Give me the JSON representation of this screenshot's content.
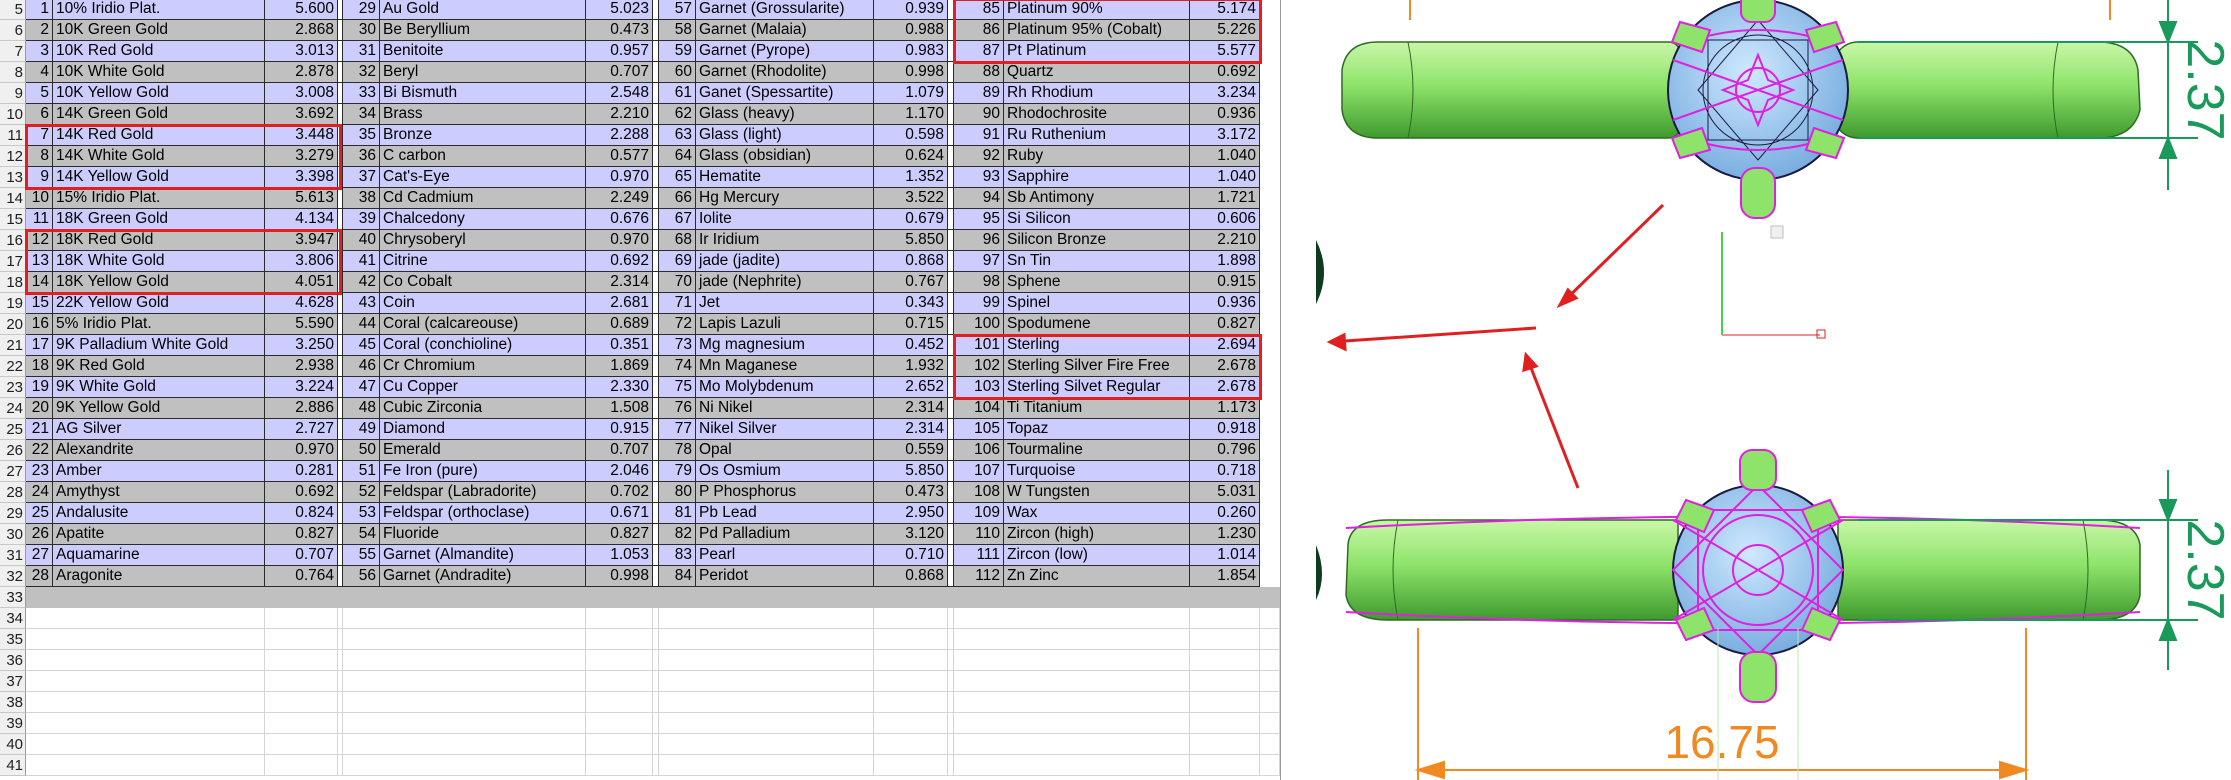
{
  "spreadsheet": {
    "first_row_number": 5,
    "columns": [
      {
        "rows": [
          [
            "1",
            "10% Iridio Plat.",
            "5.600"
          ],
          [
            "2",
            "10K Green Gold",
            "2.868"
          ],
          [
            "3",
            "10K Red Gold",
            "3.013"
          ],
          [
            "4",
            "10K White Gold",
            "2.878"
          ],
          [
            "5",
            "10K Yellow Gold",
            "3.008"
          ],
          [
            "6",
            "14K Green Gold",
            "3.692"
          ],
          [
            "7",
            "14K Red Gold",
            "3.448"
          ],
          [
            "8",
            "14K White Gold",
            "3.279"
          ],
          [
            "9",
            "14K Yellow Gold",
            "3.398"
          ],
          [
            "10",
            "15% Iridio Plat.",
            "5.613"
          ],
          [
            "11",
            "18K Green Gold",
            "4.134"
          ],
          [
            "12",
            "18K Red Gold",
            "3.947"
          ],
          [
            "13",
            "18K White Gold",
            "3.806"
          ],
          [
            "14",
            "18K Yellow Gold",
            "4.051"
          ],
          [
            "15",
            "22K Yellow Gold",
            "4.628"
          ],
          [
            "16",
            "5% Iridio Plat.",
            "5.590"
          ],
          [
            "17",
            "9K Palladium White Gold",
            "3.250"
          ],
          [
            "18",
            "9K Red Gold",
            "2.938"
          ],
          [
            "19",
            "9K White Gold",
            "3.224"
          ],
          [
            "20",
            "9K Yellow Gold",
            "2.886"
          ],
          [
            "21",
            "AG Silver",
            "2.727"
          ],
          [
            "22",
            "Alexandrite",
            "0.970"
          ],
          [
            "23",
            "Amber",
            "0.281"
          ],
          [
            "24",
            "Amythyst",
            "0.692"
          ],
          [
            "25",
            "Andalusite",
            "0.824"
          ],
          [
            "26",
            "Apatite",
            "0.827"
          ],
          [
            "27",
            "Aquamarine",
            "0.707"
          ],
          [
            "28",
            "Aragonite",
            "0.764"
          ]
        ]
      },
      {
        "rows": [
          [
            "29",
            "Au Gold",
            "5.023"
          ],
          [
            "30",
            "Be Beryllium",
            "0.473"
          ],
          [
            "31",
            "Benitoite",
            "0.957"
          ],
          [
            "32",
            "Beryl",
            "0.707"
          ],
          [
            "33",
            "Bi Bismuth",
            "2.548"
          ],
          [
            "34",
            "Brass",
            "2.210"
          ],
          [
            "35",
            "Bronze",
            "2.288"
          ],
          [
            "36",
            "C carbon",
            "0.577"
          ],
          [
            "37",
            "Cat's-Eye",
            "0.970"
          ],
          [
            "38",
            "Cd Cadmium",
            "2.249"
          ],
          [
            "39",
            "Chalcedony",
            "0.676"
          ],
          [
            "40",
            "Chrysoberyl",
            "0.970"
          ],
          [
            "41",
            "Citrine",
            "0.692"
          ],
          [
            "42",
            "Co Cobalt",
            "2.314"
          ],
          [
            "43",
            "Coin",
            "2.681"
          ],
          [
            "44",
            "Coral (calcareouse)",
            "0.689"
          ],
          [
            "45",
            "Coral (conchioline)",
            "0.351"
          ],
          [
            "46",
            "Cr Chromium",
            "1.869"
          ],
          [
            "47",
            "Cu Copper",
            "2.330"
          ],
          [
            "48",
            "Cubic Zirconia",
            "1.508"
          ],
          [
            "49",
            "Diamond",
            "0.915"
          ],
          [
            "50",
            "Emerald",
            "0.707"
          ],
          [
            "51",
            "Fe Iron (pure)",
            "2.046"
          ],
          [
            "52",
            "Feldspar (Labradorite)",
            "0.702"
          ],
          [
            "53",
            "Feldspar (orthoclase)",
            "0.671"
          ],
          [
            "54",
            "Fluoride",
            "0.827"
          ],
          [
            "55",
            "Garnet (Almandite)",
            "1.053"
          ],
          [
            "56",
            "Garnet (Andradite)",
            "0.998"
          ]
        ]
      },
      {
        "rows": [
          [
            "57",
            "Garnet (Grossularite)",
            "0.939"
          ],
          [
            "58",
            "Garnet (Malaia)",
            "0.988"
          ],
          [
            "59",
            "Garnet (Pyrope)",
            "0.983"
          ],
          [
            "60",
            "Garnet (Rhodolite)",
            "0.998"
          ],
          [
            "61",
            "Ganet (Spessartite)",
            "1.079"
          ],
          [
            "62",
            "Glass (heavy)",
            "1.170"
          ],
          [
            "63",
            "Glass (light)",
            "0.598"
          ],
          [
            "64",
            "Glass (obsidian)",
            "0.624"
          ],
          [
            "65",
            "Hematite",
            "1.352"
          ],
          [
            "66",
            "Hg Mercury",
            "3.522"
          ],
          [
            "67",
            "Iolite",
            "0.679"
          ],
          [
            "68",
            "Ir Iridium",
            "5.850"
          ],
          [
            "69",
            "jade (jadite)",
            "0.868"
          ],
          [
            "70",
            "jade (Nephrite)",
            "0.767"
          ],
          [
            "71",
            "Jet",
            "0.343"
          ],
          [
            "72",
            "Lapis Lazuli",
            "0.715"
          ],
          [
            "73",
            "Mg magnesium",
            "0.452"
          ],
          [
            "74",
            "Mn Maganese",
            "1.932"
          ],
          [
            "75",
            "Mo Molybdenum",
            "2.652"
          ],
          [
            "76",
            "Ni Nikel",
            "2.314"
          ],
          [
            "77",
            "Nikel Silver",
            "2.314"
          ],
          [
            "78",
            "Opal",
            "0.559"
          ],
          [
            "79",
            "Os Osmium",
            "5.850"
          ],
          [
            "80",
            "P Phosphorus",
            "0.473"
          ],
          [
            "81",
            "Pb Lead",
            "2.950"
          ],
          [
            "82",
            "Pd Palladium",
            "3.120"
          ],
          [
            "83",
            "Pearl",
            "0.710"
          ],
          [
            "84",
            "Peridot",
            "0.868"
          ]
        ]
      },
      {
        "rows": [
          [
            "85",
            "Platinum 90%",
            "5.174"
          ],
          [
            "86",
            "Platinum 95% (Cobalt)",
            "5.226"
          ],
          [
            "87",
            "Pt Platinum",
            "5.577"
          ],
          [
            "88",
            "Quartz",
            "0.692"
          ],
          [
            "89",
            "Rh Rhodium",
            "3.234"
          ],
          [
            "90",
            "Rhodochrosite",
            "0.936"
          ],
          [
            "91",
            "Ru Ruthenium",
            "3.172"
          ],
          [
            "92",
            "Ruby",
            "1.040"
          ],
          [
            "93",
            "Sapphire",
            "1.040"
          ],
          [
            "94",
            "Sb Antimony",
            "1.721"
          ],
          [
            "95",
            "Si Silicon",
            "0.606"
          ],
          [
            "96",
            "Silicon Bronze",
            "2.210"
          ],
          [
            "97",
            "Sn Tin",
            "1.898"
          ],
          [
            "98",
            "Sphene",
            "0.915"
          ],
          [
            "99",
            "Spinel",
            "0.936"
          ],
          [
            "100",
            "Spodumene",
            "0.827"
          ],
          [
            "101",
            "Sterling",
            "2.694"
          ],
          [
            "102",
            "Sterling Silver Fire Free",
            "2.678"
          ],
          [
            "103",
            "Sterling Silvet Regular",
            "2.678"
          ],
          [
            "104",
            "Ti Titanium",
            "1.173"
          ],
          [
            "105",
            "Topaz",
            "0.918"
          ],
          [
            "106",
            "Tourmaline",
            "0.796"
          ],
          [
            "107",
            "Turquoise",
            "0.718"
          ],
          [
            "108",
            "W Tungsten",
            "5.031"
          ],
          [
            "109",
            "Wax",
            "0.260"
          ],
          [
            "110",
            "Zircon (high)",
            "1.230"
          ],
          [
            "111",
            "Zircon (low)",
            "1.014"
          ],
          [
            "112",
            "Zn Zinc",
            "1.854"
          ]
        ]
      }
    ],
    "blank_rows": [
      "33",
      "34",
      "35",
      "36",
      "37",
      "38",
      "39",
      "40",
      "41"
    ]
  },
  "drawing": {
    "dimension_top": "2.37",
    "dimension_bottom": "2.37",
    "dimension_width": "16.75"
  },
  "colors": {
    "row_odd": "#ccccff",
    "row_even": "#c0c0c0",
    "highlight": "#e02020",
    "ring_green": "#8ee36a",
    "wire_magenta": "#e020e0",
    "dim_green": "#1a9a5a",
    "dim_orange": "#f08a20"
  }
}
